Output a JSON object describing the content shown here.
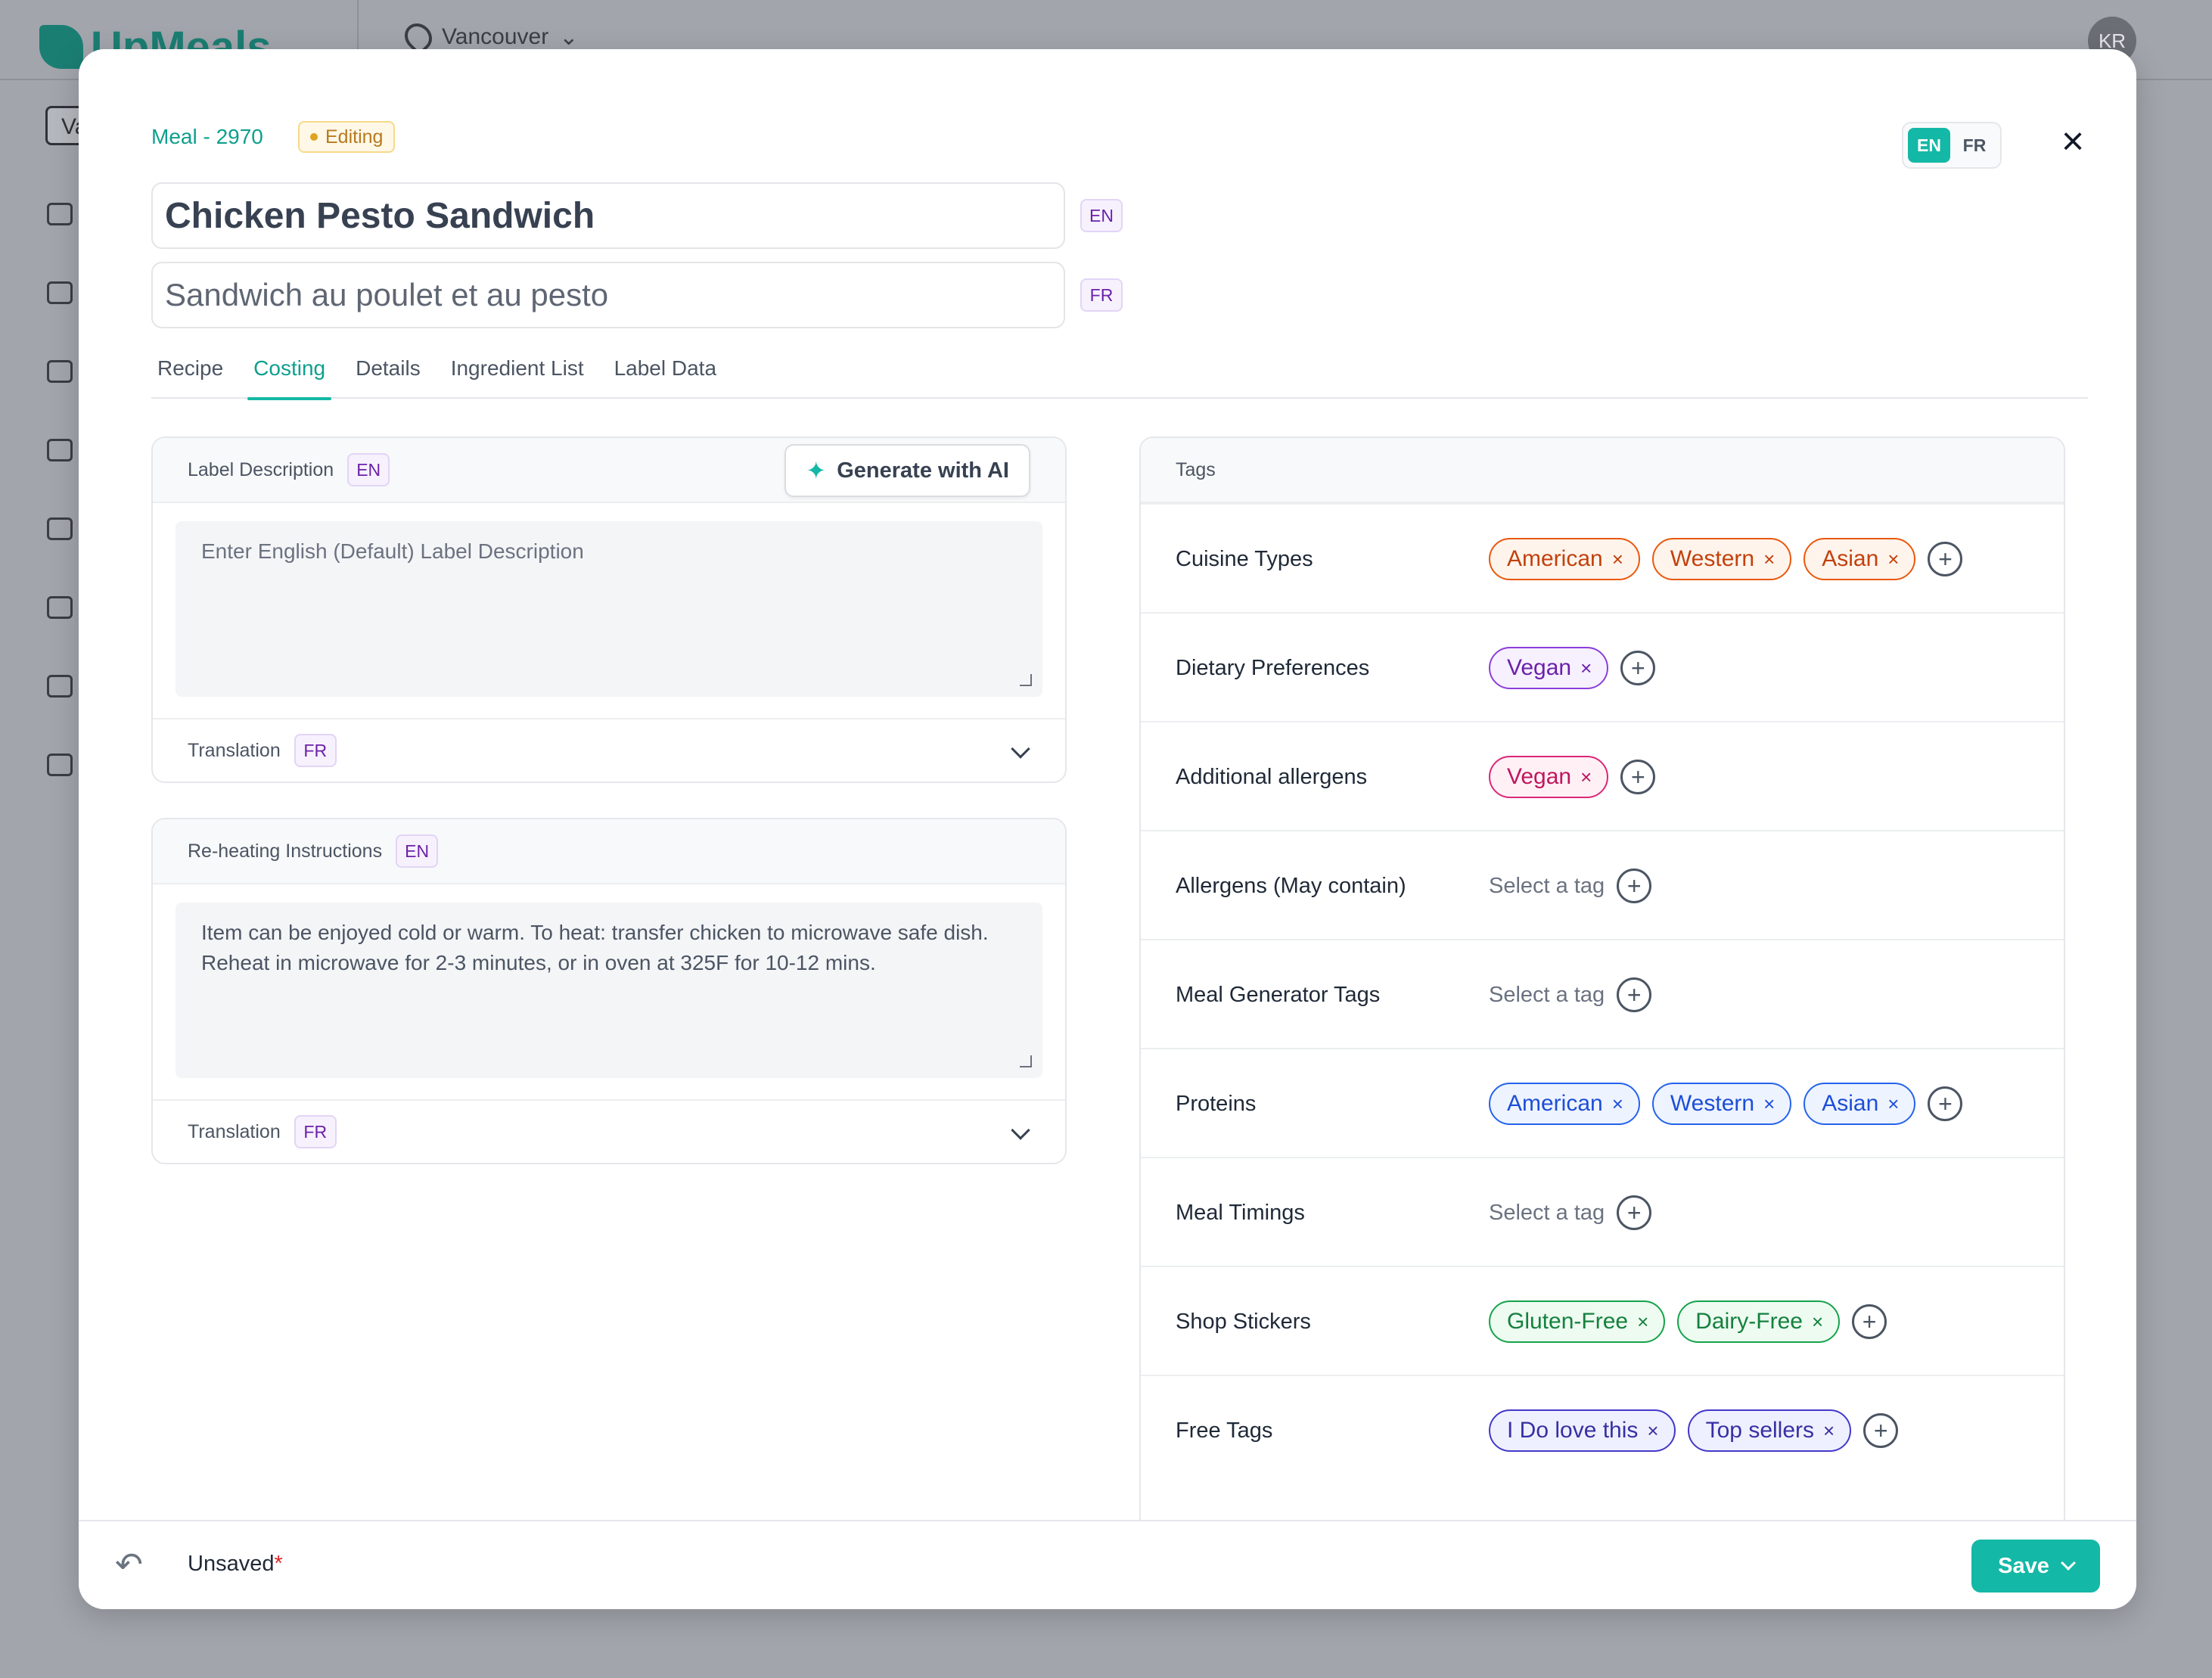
{
  "background": {
    "logo_text": "UpMeals",
    "location": "Vancouver",
    "avatar_initials": "KR",
    "selector_text": "Va"
  },
  "modal": {
    "meal_id": "Meal - 2970",
    "status": "Editing",
    "language_toggle": [
      "EN",
      "FR"
    ],
    "active_language": "EN",
    "name_en": "Chicken Pesto Sandwich",
    "name_en_lang": "EN",
    "name_fr": "Sandwich au poulet et au pesto",
    "name_fr_lang": "FR",
    "tabs": [
      "Recipe",
      "Costing",
      "Details",
      "Ingredient List",
      "Label Data"
    ],
    "active_tab": "Costing"
  },
  "label_description": {
    "title": "Label Description",
    "lang": "EN",
    "ai_button": "Generate with AI",
    "placeholder": "Enter English (Default) Label Description",
    "translation_label": "Translation",
    "translation_lang": "FR"
  },
  "reheating": {
    "title": "Re-heating Instructions",
    "lang": "EN",
    "value": "Item can be enjoyed cold or warm. To heat: transfer chicken to microwave safe dish. Reheat in microwave for 2-3 minutes, or in oven at 325F for 10-12 mins.",
    "translation_label": "Translation",
    "translation_lang": "FR"
  },
  "tags": {
    "title": "Tags",
    "select_placeholder": "Select a tag",
    "rows": [
      {
        "label": "Cuisine Types",
        "color": "orange",
        "items": [
          "American",
          "Western",
          "Asian"
        ]
      },
      {
        "label": "Dietary Preferences",
        "color": "purple",
        "items": [
          "Vegan"
        ]
      },
      {
        "label": "Additional allergens",
        "color": "pink",
        "items": [
          "Vegan"
        ]
      },
      {
        "label": "Allergens (May contain)",
        "color": "none",
        "items": []
      },
      {
        "label": "Meal Generator Tags",
        "color": "none",
        "items": []
      },
      {
        "label": "Proteins",
        "color": "blue",
        "items": [
          "American",
          "Western",
          "Asian"
        ]
      },
      {
        "label": "Meal Timings",
        "color": "none",
        "items": []
      },
      {
        "label": "Shop Stickers",
        "color": "green",
        "items": [
          "Gluten-Free",
          "Dairy-Free"
        ]
      },
      {
        "label": "Free Tags",
        "color": "indigo",
        "items": [
          "I Do love this",
          "Top sellers"
        ]
      }
    ]
  },
  "footer": {
    "status": "Unsaved",
    "status_mark": "*",
    "save_label": "Save"
  },
  "colors": {
    "accent": "#14b8a6",
    "warning_badge": "#b7791f"
  }
}
